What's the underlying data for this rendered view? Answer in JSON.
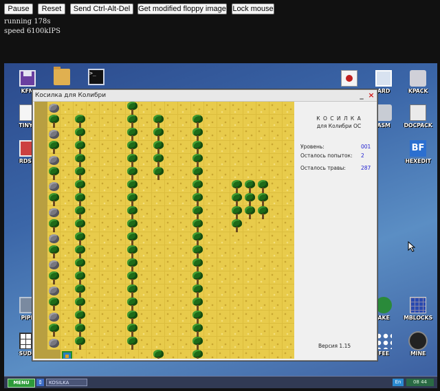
{
  "toolbar": {
    "pause": "Pause",
    "reset": "Reset",
    "ctrl_alt_del": "Send Ctrl-Alt-Del",
    "floppy": "Get modified floppy image",
    "lock_mouse": "Lock mouse"
  },
  "status": {
    "running": "running 178s",
    "speed": "speed 6100kIPS"
  },
  "desktop": {
    "icons_left": [
      "KFM",
      "TINYF",
      "RDSN",
      "PIPE",
      "SUDO"
    ],
    "icons_right": [
      "ARD",
      "KPACK",
      "ASM",
      "DOCPACK",
      "HEXEDIT",
      "AKE",
      "MBLOCKS",
      "FEE",
      "MINE"
    ]
  },
  "window": {
    "title": "Косилка для Колибри",
    "minimize": "_",
    "close": "×"
  },
  "game": {
    "heading": "К О С И Л К А",
    "subheading": "для Колибри ОС",
    "level_label": "Уровень:",
    "level_value": "001",
    "attempts_label": "Осталось попыток:",
    "attempts_value": "2",
    "grass_label": "Осталось травы:",
    "grass_value": "287",
    "version": "Версия 1.15"
  },
  "taskbar": {
    "menu": "MENU",
    "switch": "⇕",
    "app": "KOSILKA",
    "lang": "En",
    "clock": "08 44"
  },
  "colors": {
    "grass": "#e8cb4b",
    "mowed": "#b89f41",
    "tree": "#1e6a18",
    "accent_blue": "#1a1ad0"
  }
}
